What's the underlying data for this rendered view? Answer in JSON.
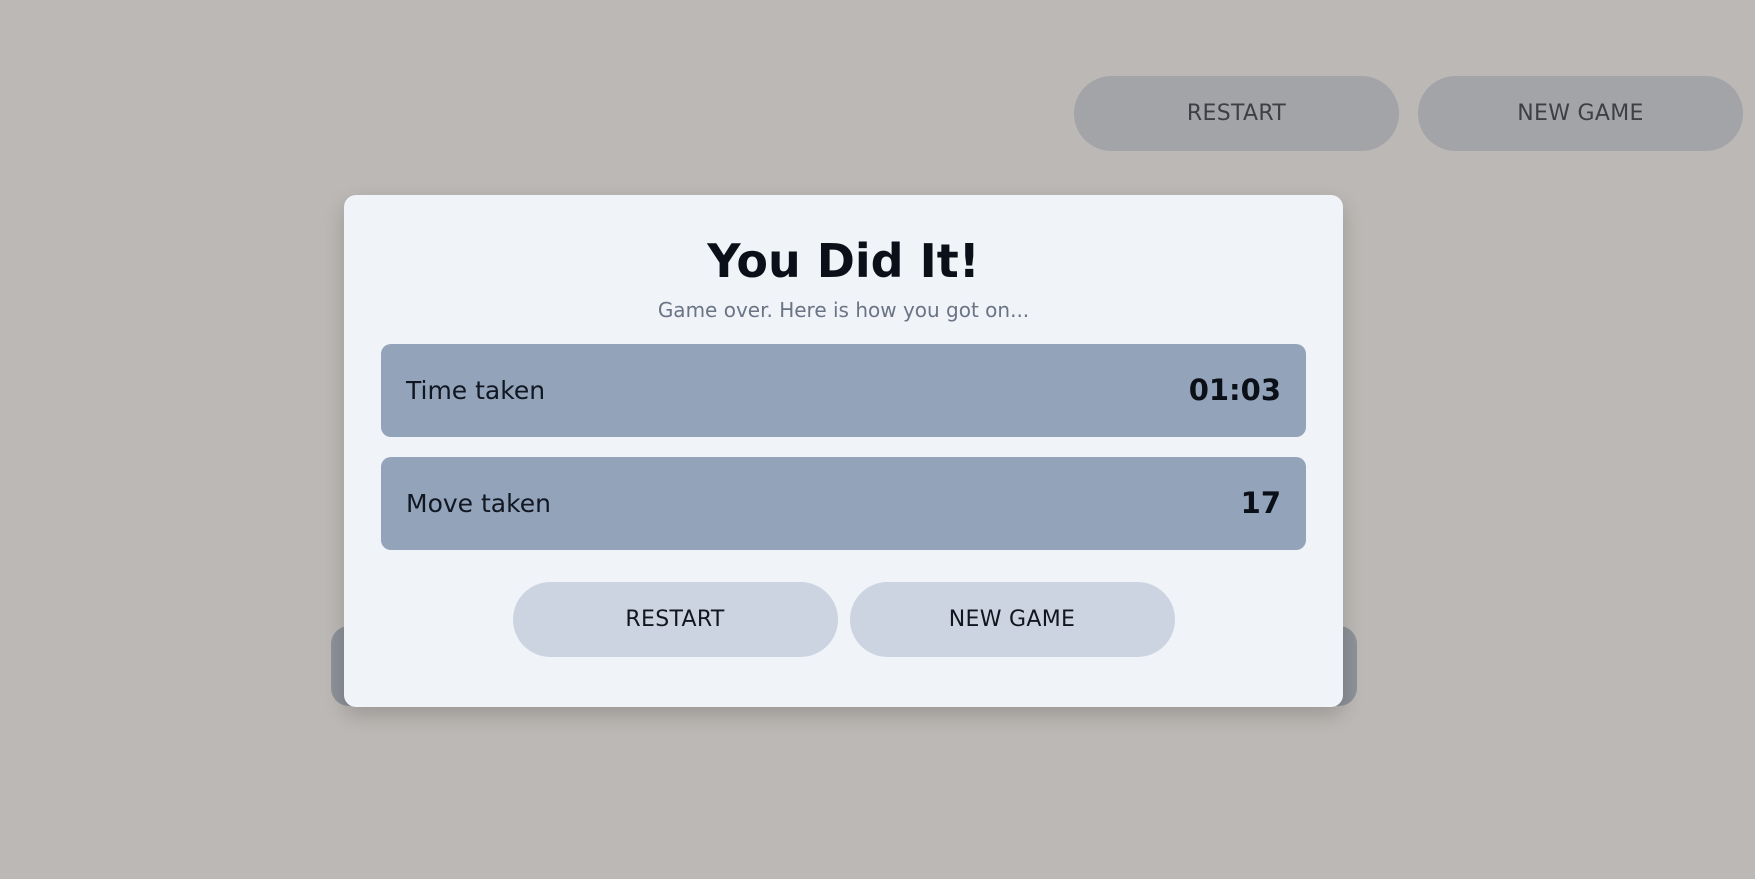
{
  "header": {
    "restart_label": "RESTART",
    "new_game_label": "NEW GAME"
  },
  "modal": {
    "title": "You Did It!",
    "subtitle": "Game over. Here is how you got on...",
    "stats": [
      {
        "label": "Time taken",
        "value": "01:03"
      },
      {
        "label": "Move taken",
        "value": "17"
      }
    ],
    "restart_label": "RESTART",
    "new_game_label": "NEW GAME"
  },
  "colors": {
    "page_background": "#bcb8b5",
    "modal_background": "#f0f3f8",
    "stat_background": "#93a3b9",
    "modal_button": "#cbd4e0",
    "header_button": "#a3a4a8"
  }
}
